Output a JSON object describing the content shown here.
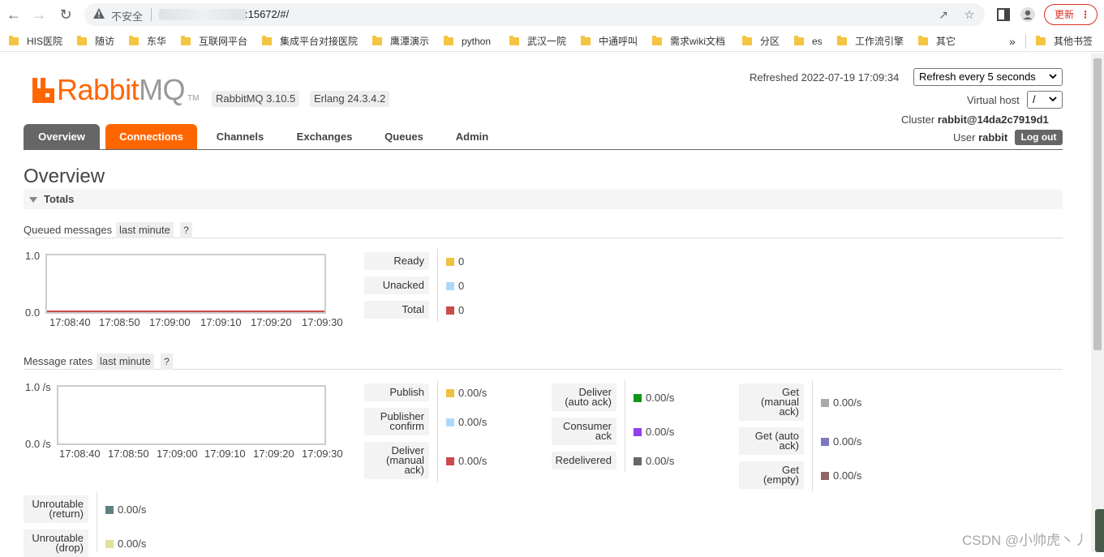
{
  "browser": {
    "insecure_label": "不安全",
    "url_visible": ":15672/#/",
    "update_label": "更新",
    "bookmarks": [
      "HIS医院",
      "随访",
      "东华",
      "互联网平台",
      "集成平台对接医院",
      "鹰潭演示",
      "python",
      "武汉一院",
      "中通呼叫",
      "需求wiki文档",
      "分区",
      "es",
      "工作流引擎",
      "其它"
    ],
    "more_bookmarks": "»",
    "other_bookmarks": "其他书签"
  },
  "header": {
    "logo_rabbit": "Rabbit",
    "logo_mq": "MQ",
    "logo_tm": "TM",
    "version_badge": "RabbitMQ 3.10.5",
    "erlang_badge": "Erlang 24.3.4.2",
    "refreshed_text": "Refreshed 2022-07-19 17:09:34",
    "refresh_option": "Refresh every 5 seconds",
    "vhost_label": "Virtual host",
    "vhost_value": "/",
    "cluster_label": "Cluster",
    "cluster_value": "rabbit@14da2c7919d1",
    "user_label": "User",
    "user_value": "rabbit",
    "logout_label": "Log out"
  },
  "tabs": [
    "Overview",
    "Connections",
    "Channels",
    "Exchanges",
    "Queues",
    "Admin"
  ],
  "page_title": "Overview",
  "totals": {
    "title": "Totals",
    "queued": {
      "label": "Queued messages",
      "range": "last minute",
      "help": "?",
      "y_max": "1.0",
      "y_min": "0.0",
      "x_ticks": [
        "17:08:40",
        "17:08:50",
        "17:09:00",
        "17:09:10",
        "17:09:20",
        "17:09:30"
      ],
      "legend": [
        {
          "label": "Ready",
          "value": "0",
          "color": "#edc240"
        },
        {
          "label": "Unacked",
          "value": "0",
          "color": "#afd8f8"
        },
        {
          "label": "Total",
          "value": "0",
          "color": "#cb4b4b"
        }
      ]
    },
    "rates": {
      "label": "Message rates",
      "range": "last minute",
      "help": "?",
      "y_max": "1.0 /s",
      "y_min": "0.0 /s",
      "x_ticks": [
        "17:08:40",
        "17:08:50",
        "17:09:00",
        "17:09:10",
        "17:09:20",
        "17:09:30"
      ],
      "col1": [
        {
          "label": "Publish",
          "value": "0.00/s",
          "color": "#edc240"
        },
        {
          "label": "Publisher confirm",
          "value": "0.00/s",
          "color": "#afd8f8"
        },
        {
          "label": "Deliver (manual ack)",
          "value": "0.00/s",
          "color": "#cb4b4b"
        }
      ],
      "col2": [
        {
          "label": "Deliver (auto ack)",
          "value": "0.00/s",
          "color": "#109618"
        },
        {
          "label": "Consumer ack",
          "value": "0.00/s",
          "color": "#9440ed"
        },
        {
          "label": "Redelivered",
          "value": "0.00/s",
          "color": "#666666"
        }
      ],
      "col3": [
        {
          "label": "Get (manual ack)",
          "value": "0.00/s",
          "color": "#aaaaaa"
        },
        {
          "label": "Get (auto ack)",
          "value": "0.00/s",
          "color": "#7c79c3"
        },
        {
          "label": "Get (empty)",
          "value": "0.00/s",
          "color": "#8d6666"
        }
      ],
      "col4": [
        {
          "label": "Unroutable (return)",
          "value": "0.00/s",
          "color": "#617f84"
        },
        {
          "label": "Unroutable (drop)",
          "value": "0.00/s",
          "color": "#e0e0a0"
        }
      ]
    }
  },
  "watermark": "CSDN @小帅虎丶丿"
}
